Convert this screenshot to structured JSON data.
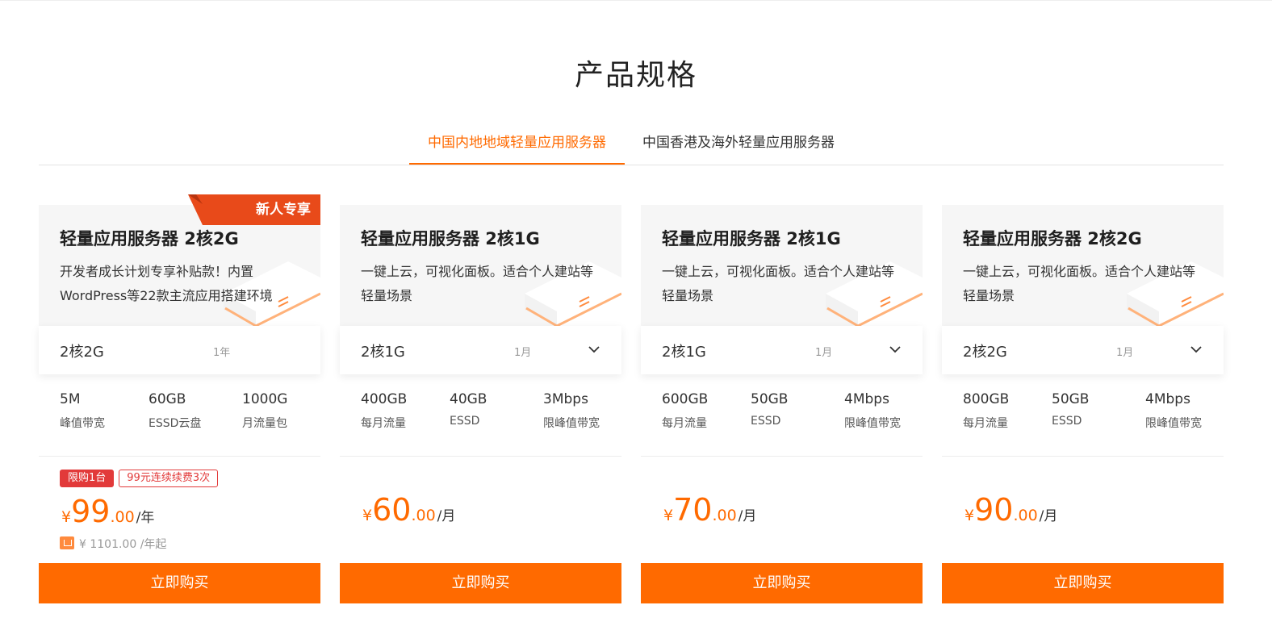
{
  "page": {
    "title": "产品规格"
  },
  "tabs": [
    {
      "label": "中国内地地域轻量应用服务器",
      "active": true
    },
    {
      "label": "中国香港及海外轻量应用服务器",
      "active": false
    }
  ],
  "colors": {
    "accent": "#ff6a00",
    "badge": "#e84a1a",
    "tag_red": "#e23a3a"
  },
  "cards": [
    {
      "badge": "新人专享",
      "title": "轻量应用服务器 2核2G",
      "desc": "开发者成长计划专享补贴款！内置WordPress等22款主流应用搭建环境",
      "spec": "2核2G",
      "period": "1年",
      "has_dropdown": false,
      "metrics": [
        {
          "value": "5M",
          "label": "峰值带宽"
        },
        {
          "value": "60GB",
          "label": "ESSD云盘"
        },
        {
          "value": "1000G",
          "label": "月流量包"
        }
      ],
      "tags": [
        "限购1台",
        "99元连续续费3次"
      ],
      "price": {
        "currency": "¥",
        "int": "99",
        "dec": ".00",
        "unit": "/年"
      },
      "original": "¥ 1101.00 /年起",
      "buy_label": "立即购买"
    },
    {
      "title": "轻量应用服务器 2核1G",
      "desc": "一键上云，可视化面板。适合个人建站等轻量场景",
      "spec": "2核1G",
      "period": "1月",
      "has_dropdown": true,
      "metrics": [
        {
          "value": "400GB",
          "label": "每月流量"
        },
        {
          "value": "40GB",
          "label": "ESSD"
        },
        {
          "value": "3Mbps",
          "label": "限峰值带宽"
        }
      ],
      "price": {
        "currency": "¥",
        "int": "60",
        "dec": ".00",
        "unit": "/月"
      },
      "buy_label": "立即购买"
    },
    {
      "title": "轻量应用服务器 2核1G",
      "desc": "一键上云，可视化面板。适合个人建站等轻量场景",
      "spec": "2核1G",
      "period": "1月",
      "has_dropdown": true,
      "metrics": [
        {
          "value": "600GB",
          "label": "每月流量"
        },
        {
          "value": "50GB",
          "label": "ESSD"
        },
        {
          "value": "4Mbps",
          "label": "限峰值带宽"
        }
      ],
      "price": {
        "currency": "¥",
        "int": "70",
        "dec": ".00",
        "unit": "/月"
      },
      "buy_label": "立即购买"
    },
    {
      "title": "轻量应用服务器 2核2G",
      "desc": "一键上云，可视化面板。适合个人建站等轻量场景",
      "spec": "2核2G",
      "period": "1月",
      "has_dropdown": true,
      "metrics": [
        {
          "value": "800GB",
          "label": "每月流量"
        },
        {
          "value": "50GB",
          "label": "ESSD"
        },
        {
          "value": "4Mbps",
          "label": "限峰值带宽"
        }
      ],
      "price": {
        "currency": "¥",
        "int": "90",
        "dec": ".00",
        "unit": "/月"
      },
      "buy_label": "立即购买"
    }
  ]
}
